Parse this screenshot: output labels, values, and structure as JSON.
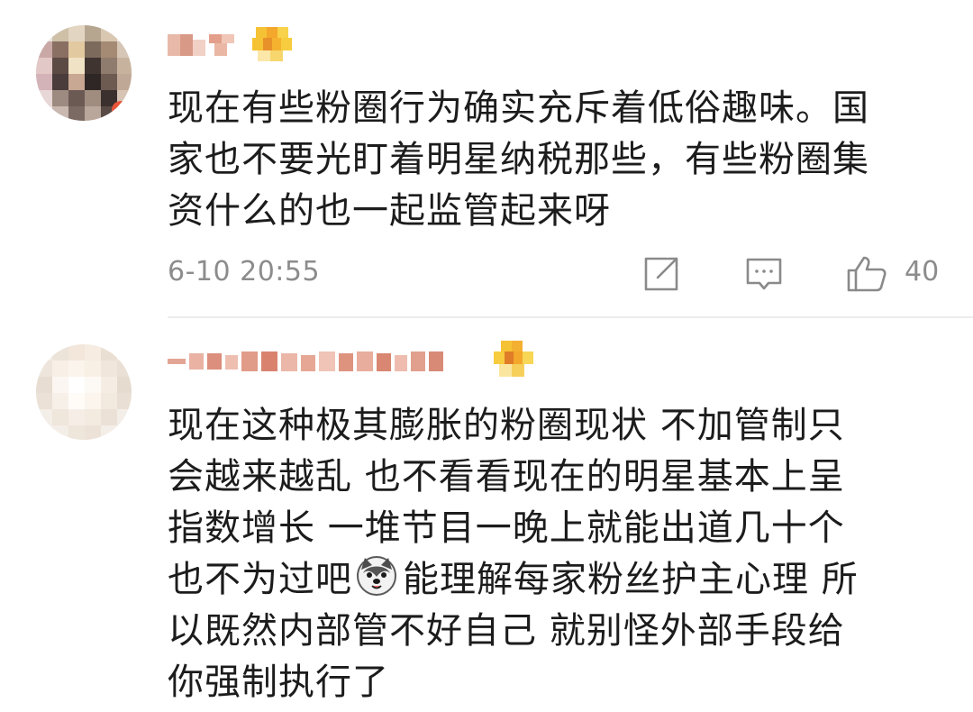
{
  "comments": [
    {
      "username_blurred": true,
      "has_badge": true,
      "lines": [
        "现在有些粉圈行为确实充斥着低俗趣味。国",
        "家也不要光盯着明星纳税那些，有些粉圈集",
        "资什么的也一起监管起来呀"
      ],
      "timestamp": "6-10 20:55",
      "likes": "40"
    },
    {
      "username_blurred": true,
      "has_badge": true,
      "lines": [
        "现在这种极其膨胀的粉圈现状 不加管制只",
        "会越来越乱 也不看看现在的明星基本上呈",
        "指数增长 一堆节目一晚上就能出道几十个"
      ],
      "line4_before": "也不为过吧",
      "line4_emoji": "husky-emoji",
      "line4_after": "能理解每家粉丝护主心理 所",
      "lines_end": [
        "以既然内部管不好自己 就别怪外部手段给",
        "你强制执行了"
      ]
    }
  ],
  "icons": {
    "share": "share-icon",
    "reply": "comment-icon",
    "like": "thumbs-up-icon"
  },
  "colors": {
    "text": "#1c1c1c",
    "meta": "#8c8c8c",
    "icon": "#8a8a8a",
    "divider": "#ececec"
  }
}
